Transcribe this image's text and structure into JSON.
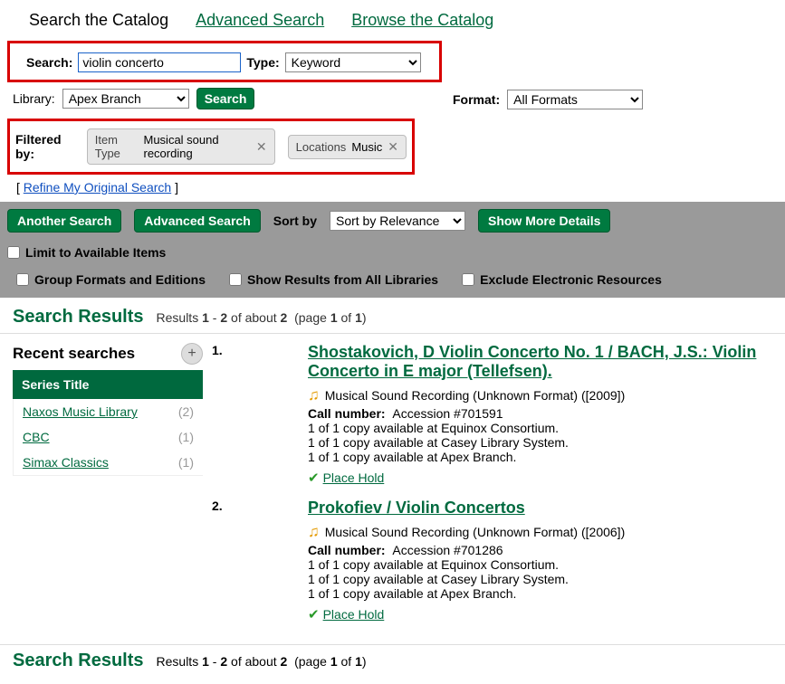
{
  "topnav": {
    "catalog": "Search the Catalog",
    "advanced": "Advanced Search",
    "browse": "Browse the Catalog"
  },
  "searchform": {
    "search_label": "Search:",
    "query": "violin concerto",
    "type_label": "Type:",
    "type_value": "Keyword",
    "format_label": "Format:",
    "format_value": "All Formats",
    "library_label": "Library:",
    "library_value": "Apex Branch",
    "search_btn": "Search"
  },
  "filters": {
    "label": "Filtered by:",
    "chips": [
      {
        "name": "Item Type",
        "value": "Musical sound recording"
      },
      {
        "name": "Locations",
        "value": "Music"
      }
    ]
  },
  "refine": {
    "open": "[ ",
    "text": "Refine My Original Search",
    "close": " ]"
  },
  "gray": {
    "another": "Another Search",
    "advanced": "Advanced Search",
    "sortlbl": "Sort by",
    "sortval": "Sort by Relevance",
    "more": "Show More Details",
    "limit": "Limit to Available Items",
    "group": "Group Formats and Editions",
    "allLibs": "Show Results from All Libraries",
    "exclude": "Exclude Electronic Resources"
  },
  "resultsHeader": {
    "title": "Search Results",
    "counts_html": "Results <b>1</b> - <b>2</b> of about <b>2</b>  (page <b>1</b> of <b>1</b>)"
  },
  "recent": {
    "title": "Recent searches"
  },
  "facet": {
    "header": "Series Title",
    "items": [
      {
        "label": "Naxos Music Library",
        "count": "(2)"
      },
      {
        "label": "CBC",
        "count": "(1)"
      },
      {
        "label": "Simax Classics",
        "count": "(1)"
      }
    ]
  },
  "records": [
    {
      "num": "1.",
      "title": "Shostakovich, D Violin Concerto No. 1 / BACH, J.S.: Violin Concerto in E major (Tellefsen).",
      "format": "Musical Sound Recording (Unknown Format) ([2009])",
      "callnum_lbl": "Call number:",
      "callnum": "Accession #701591",
      "avail": [
        "1 of 1 copy available at Equinox Consortium.",
        "1 of 1 copy available at Casey Library System.",
        "1 of 1 copy available at Apex Branch."
      ],
      "hold": "Place Hold"
    },
    {
      "num": "2.",
      "title": "Prokofiev / Violin Concertos",
      "format": "Musical Sound Recording (Unknown Format) ([2006])",
      "callnum_lbl": "Call number:",
      "callnum": "Accession #701286",
      "avail": [
        "1 of 1 copy available at Equinox Consortium.",
        "1 of 1 copy available at Casey Library System.",
        "1 of 1 copy available at Apex Branch."
      ],
      "hold": "Place Hold"
    }
  ]
}
